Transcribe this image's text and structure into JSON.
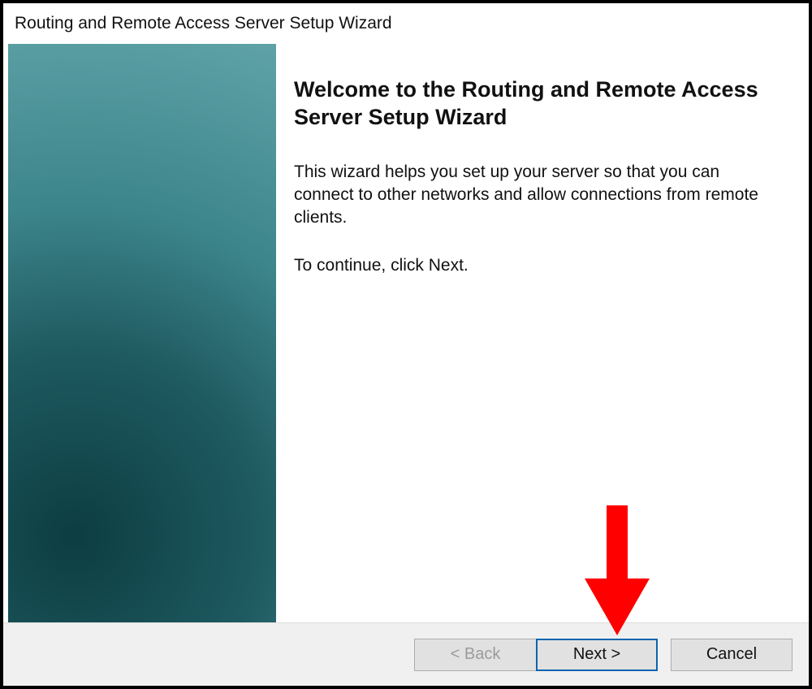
{
  "title": "Routing and Remote Access Server Setup Wizard",
  "heading": "Welcome to the Routing and Remote Access Server Setup Wizard",
  "description": "This wizard helps you set up your server so that you can connect to other networks and allow connections from remote clients.",
  "continue_hint": "To continue, click Next.",
  "buttons": {
    "back": "< Back",
    "next": "Next >",
    "cancel": "Cancel"
  },
  "annotation": {
    "arrow_color": "#ff0000",
    "points_to": "next-button"
  }
}
